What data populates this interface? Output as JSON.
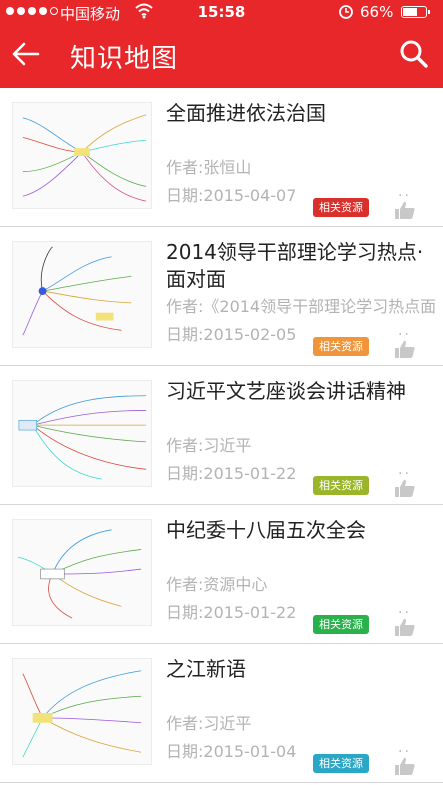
{
  "status_bar": {
    "carrier": "中国移动",
    "time": "15:58",
    "battery": "66%",
    "battery_level": 0.66
  },
  "header": {
    "title": "知识地图",
    "back_icon": "arrow-left-icon",
    "search_icon": "search-icon",
    "color": "#e8272b"
  },
  "items": [
    {
      "title": "全面推进依法治国",
      "author": "作者:张恒山",
      "date": "日期:2015-04-07",
      "badge": "相关资源",
      "badge_color": "#d9302c"
    },
    {
      "title": "2014领导干部理论学习热点·面对面",
      "author": "作者:《2014领导干部理论学习热点面",
      "date": "日期:2015-02-05",
      "badge": "相关资源",
      "badge_color": "#f0953a"
    },
    {
      "title": "习近平文艺座谈会讲话精神",
      "author": "作者:习近平",
      "date": "日期:2015-01-22",
      "badge": "相关资源",
      "badge_color": "#9bb52a"
    },
    {
      "title": "中纪委十八届五次全会",
      "author": "作者:资源中心",
      "date": "日期:2015-01-22",
      "badge": "相关资源",
      "badge_color": "#2bb14c"
    },
    {
      "title": "之江新语",
      "author": "作者:习近平",
      "date": "日期:2015-01-04",
      "badge": "相关资源",
      "badge_color": "#2aa7c6"
    }
  ]
}
